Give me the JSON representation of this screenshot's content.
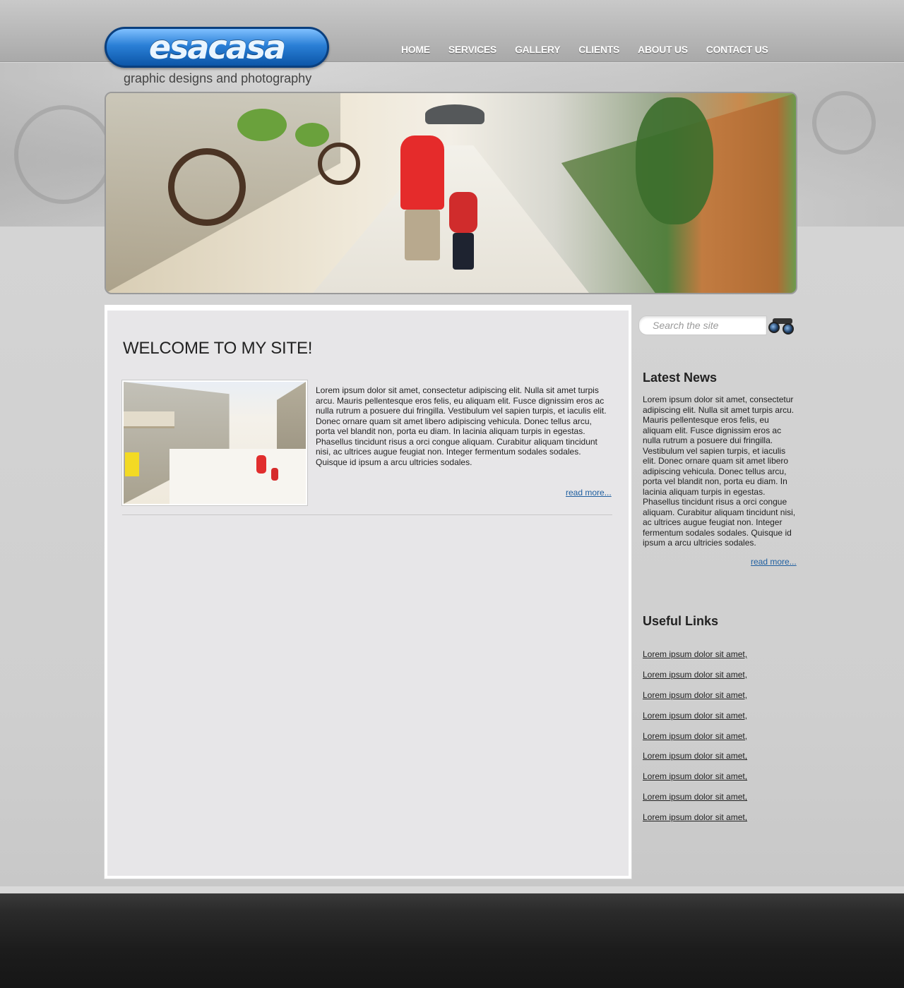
{
  "brand": {
    "logo_text": "esacasa",
    "tagline": "graphic designs and photography",
    "accent_color": "#1a6fcf"
  },
  "nav": {
    "items": [
      {
        "label": "HOME"
      },
      {
        "label": "SERVICES"
      },
      {
        "label": "GALLERY"
      },
      {
        "label": "CLIENTS"
      },
      {
        "label": "ABOUT US"
      },
      {
        "label": "CONTACT US"
      }
    ]
  },
  "main": {
    "heading": "WELCOME TO MY SITE!",
    "body": "Lorem ipsum dolor sit amet, consectetur adipiscing elit. Nulla sit amet turpis arcu. Mauris pellentesque eros felis, eu aliquam elit. Fusce dignissim eros ac nulla rutrum a posuere dui fringilla. Vestibulum vel sapien turpis, et iaculis elit. Donec ornare quam sit amet libero adipiscing vehicula. Donec tellus arcu, porta vel blandit non, porta eu diam. In lacinia aliquam turpis in egestas. Phasellus tincidunt risus a orci congue aliquam. Curabitur aliquam tincidunt nisi, ac ultrices augue feugiat non. Integer fermentum sodales sodales. Quisque id ipsum a arcu ultricies sodales.",
    "read_more": "read more..."
  },
  "sidebar": {
    "search_placeholder": "Search the site",
    "search_icon": "binoculars-icon",
    "news_title": "Latest News",
    "news_body": "Lorem ipsum dolor sit amet, consectetur adipiscing elit. Nulla sit amet turpis arcu. Mauris pellentesque eros felis, eu aliquam elit. Fusce dignissim eros ac nulla rutrum a posuere dui fringilla. Vestibulum vel sapien turpis, et iaculis elit. Donec ornare quam sit amet libero adipiscing vehicula. Donec tellus arcu, porta vel blandit non, porta eu diam. In lacinia aliquam turpis in egestas. Phasellus tincidunt risus a orci congue aliquam. Curabitur aliquam tincidunt nisi, ac ultrices augue feugiat non. Integer fermentum sodales sodales. Quisque id ipsum a arcu ultricies sodales.",
    "news_read_more": "read more...",
    "links_title": "Useful Links",
    "links": [
      "Lorem ipsum dolor sit amet,",
      "Lorem ipsum dolor sit amet,",
      "Lorem ipsum dolor sit amet,",
      "Lorem ipsum dolor sit amet,",
      "Lorem ipsum dolor sit amet,",
      "Lorem ipsum dolor sit amet,",
      "Lorem ipsum dolor sit amet,",
      "Lorem ipsum dolor sit amet,",
      "Lorem ipsum dolor sit amet,"
    ]
  }
}
